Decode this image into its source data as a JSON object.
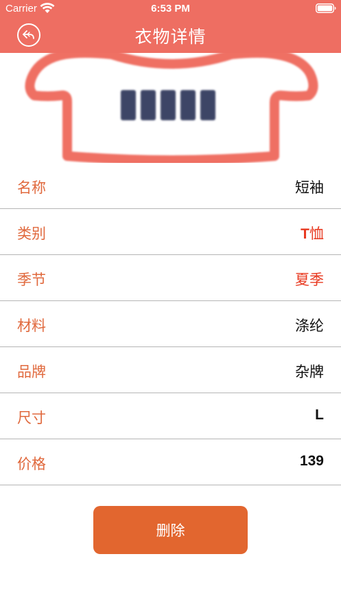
{
  "status_bar": {
    "carrier": "Carrier",
    "time": "6:53 PM",
    "wifi_icon": "wifi-icon",
    "battery_icon": "battery-icon"
  },
  "nav": {
    "title": "衣物详情",
    "back_icon": "back-arrow-icon"
  },
  "colors": {
    "accent": "#ee6e62",
    "label": "#e0683c",
    "highlight": "#e8381f",
    "button": "#e2662f",
    "shirt_stripes": "#3e4566"
  },
  "details": [
    {
      "label": "名称",
      "value": "短袖",
      "style": "normal"
    },
    {
      "label": "类别",
      "value": "T恤",
      "style": "red-bold"
    },
    {
      "label": "季节",
      "value": "夏季",
      "style": "red"
    },
    {
      "label": "材料",
      "value": "涤纶",
      "style": "normal"
    },
    {
      "label": "品牌",
      "value": "杂牌",
      "style": "normal"
    },
    {
      "label": "尺寸",
      "value": "L",
      "style": "bold"
    },
    {
      "label": "价格",
      "value": "139",
      "style": "bold"
    }
  ],
  "delete_label": "删除"
}
